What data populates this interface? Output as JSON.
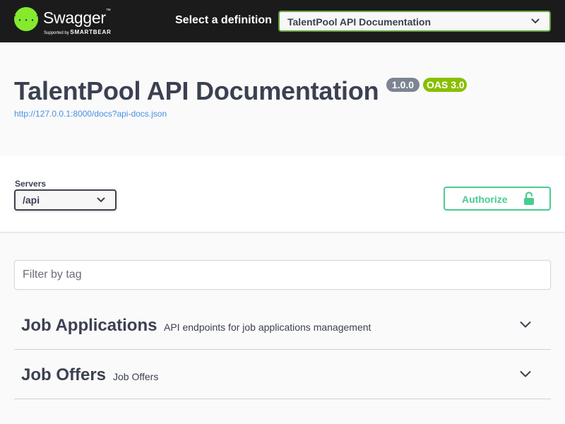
{
  "topbar": {
    "logo_title": "Swagger",
    "logo_sub_prefix": "Supported by ",
    "logo_sub_brand": "SMARTBEAR",
    "definition_label": "Select a definition",
    "definition_value": "TalentPool API Documentation"
  },
  "info": {
    "title": "TalentPool API Documentation",
    "version_badge": "1.0.0",
    "oas_badge": "OAS 3.0",
    "spec_url": "http://127.0.0.1:8000/docs?api-docs.json"
  },
  "servers": {
    "label": "Servers",
    "selected": "/api"
  },
  "authorize": {
    "label": "Authorize"
  },
  "filter": {
    "placeholder": "Filter by tag",
    "value": ""
  },
  "tags": [
    {
      "name": "Job Applications",
      "description": "API endpoints for job applications management"
    },
    {
      "name": "Job Offers",
      "description": "Job Offers"
    }
  ],
  "colors": {
    "topbar_bg": "#1b1b1b",
    "accent_green": "#62a03f",
    "authorize_green": "#49cc90",
    "oas_badge": "#89bf04",
    "version_badge": "#7d8492",
    "link_blue": "#4990e2",
    "text": "#3b4151"
  },
  "icons": {
    "logo": "swagger-braces-logo",
    "select_chevron": "chevron-down-icon",
    "authorize": "unlocked-padlock-icon",
    "tag_toggle": "chevron-down-icon"
  }
}
